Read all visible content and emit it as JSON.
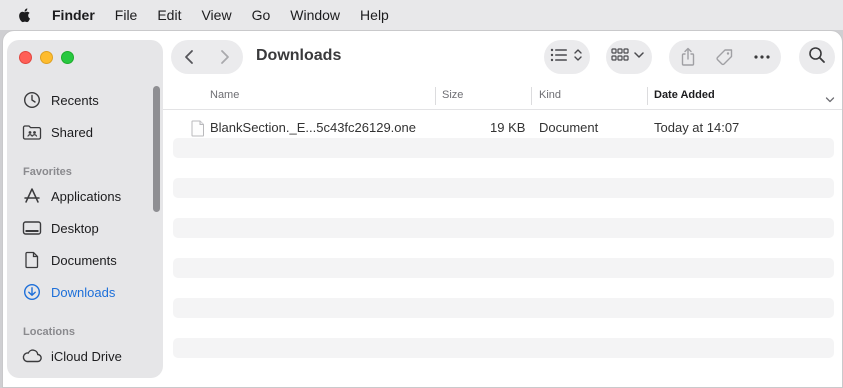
{
  "menubar": {
    "app_name": "Finder",
    "items": [
      "File",
      "Edit",
      "View",
      "Go",
      "Window",
      "Help"
    ]
  },
  "window": {
    "title": "Downloads"
  },
  "sidebar": {
    "items_top": [
      {
        "label": "Recents",
        "icon": "clock-icon"
      },
      {
        "label": "Shared",
        "icon": "shared-folder-icon"
      }
    ],
    "favorites_heading": "Favorites",
    "favorites": [
      {
        "label": "Applications",
        "icon": "applications-icon"
      },
      {
        "label": "Desktop",
        "icon": "desktop-icon"
      },
      {
        "label": "Documents",
        "icon": "document-icon"
      },
      {
        "label": "Downloads",
        "icon": "download-icon",
        "active": true
      }
    ],
    "locations_heading": "Locations",
    "locations": [
      {
        "label": "iCloud Drive",
        "icon": "cloud-icon"
      }
    ]
  },
  "columns": {
    "name": "Name",
    "size": "Size",
    "kind": "Kind",
    "date_added": "Date Added"
  },
  "files": [
    {
      "name": "BlankSection._E...5c43fc26129.one",
      "size": "19 KB",
      "kind": "Document",
      "date_added": "Today at 14:07"
    }
  ],
  "colors": {
    "accent": "#1d6fd9",
    "close": "#ff5f57",
    "minimize": "#febc2e",
    "zoom": "#28c840"
  }
}
